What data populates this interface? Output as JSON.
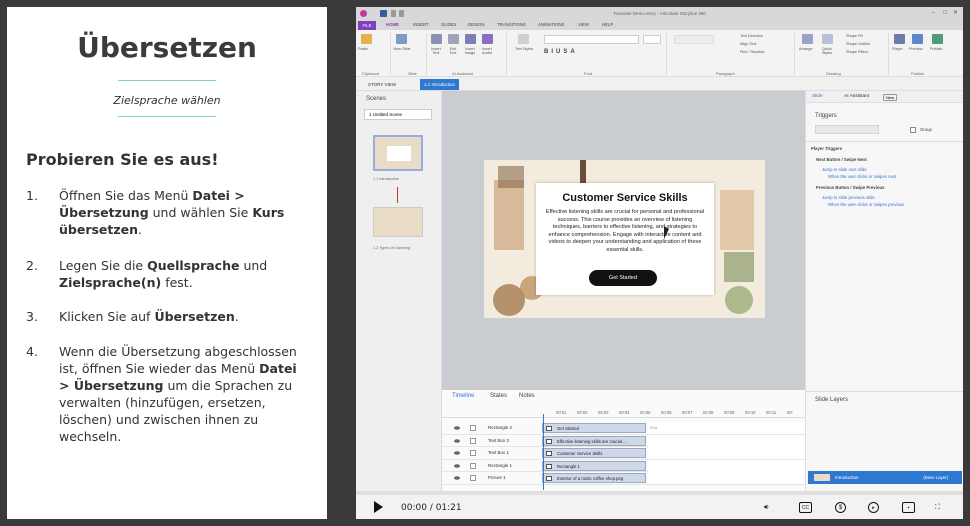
{
  "left": {
    "title": "Übersetzen",
    "subtitle": "Zielsprache wählen",
    "heading": "Probieren Sie es aus!",
    "steps": [
      {
        "num": "1.",
        "html": "Öffnen Sie das Menü <b>Datei > Übersetzung</b> und wählen Sie <b>Kurs übersetzen</b>."
      },
      {
        "num": "2.",
        "html": "Legen Sie die <b>Quellsprache</b> und <b>Zielsprache(n)</b> fest."
      },
      {
        "num": "3.",
        "html": "Klicken Sie auf <b>Übersetzen</b>."
      },
      {
        "num": "4.",
        "html": "Wenn die Übersetzung abgeschlossen ist, öffnen Sie wieder das Menü <b>Datei > Übersetzung</b> um die Sprachen zu verwalten (hinzufügen, ersetzen, löschen) und zwischen ihnen zu wechseln."
      }
    ]
  },
  "app": {
    "window_title": "Translate Demo.story - Articulate Storyline 360",
    "ribbon_tabs": [
      "FILE",
      "HOME",
      "INSERT",
      "SLIDES",
      "DESIGN",
      "TRANSITIONS",
      "ANIMATIONS",
      "VIEW",
      "HELP"
    ],
    "ribbon_groups": [
      "Clipboard",
      "Slide",
      "AI Assistant",
      "Font",
      "Paragraph",
      "Drawing",
      "Publish"
    ],
    "ribbon_buttons": [
      "Paste",
      "New Slide",
      "Insert Text",
      "Edit Text",
      "Insert Image",
      "Insert Audio",
      "Text Styles",
      "Arrange",
      "Quick Styles",
      "Player",
      "Preview",
      "Publish"
    ],
    "ribbon_small": [
      "Text Direction",
      "Align Text",
      "Find / Replace",
      "Shape Fill",
      "Shape Outline",
      "Shape Effect"
    ],
    "view_tabs": [
      "STORY VIEW",
      "1.1 Introduction"
    ],
    "scenes_header": "Scenes",
    "scene_select": "1 Untitled Scene",
    "thumbs": [
      "1.1 Introduction",
      "1.2 Types of Listening"
    ],
    "slide": {
      "title": "Customer Service Skills",
      "body": "Effective listening skills are crucial for personal and professional success. This course provides an overview of listening techniques, barriers to effective listening, and strategies to enhance comprehension. Engage with interactive content and videos to deepen your understanding and application of these essential skills.",
      "button": "Get Started"
    },
    "right_panel": {
      "tab_slide": "Slide",
      "tab_ai": "AI Assistant",
      "new_badge": "New",
      "triggers": "Triggers",
      "group": "Group",
      "player_triggers": "Player Triggers",
      "trig1_head": "Next Button / Swipe Next",
      "trig1_a": "Jump to slide next slide",
      "trig1_b": "When the user clicks or swipes next",
      "trig2_head": "Previous Button / Swipe Previous",
      "trig2_a": "Jump to slide previous slide",
      "trig2_b": "When the user clicks or swipes previous",
      "slide_layers": "Slide Layers",
      "base_layer": "Introduction",
      "base_tag": "(Base Layer)"
    },
    "timeline": {
      "tabs": [
        "Timeline",
        "States",
        "Notes"
      ],
      "ticks": [
        "00:01",
        "00:02",
        "00:03",
        "00:04",
        "00:05",
        "00:06",
        "00:07",
        "00:08",
        "00:09",
        "00:10",
        "00:11",
        "00:"
      ],
      "rows": [
        {
          "name": "Rectangle 2",
          "block": "Get Started"
        },
        {
          "name": "Text Box 2",
          "block": "Effective listening skills are crucial ..."
        },
        {
          "name": "Text Box 1",
          "block": "Customer Service Skills"
        },
        {
          "name": "Rectangle 1",
          "block": "Rectangle 1"
        },
        {
          "name": "Picture 1",
          "block": "Exterior of a rustic coffee shop.png"
        }
      ],
      "end_label": "End"
    },
    "player": {
      "time": "00:00 / 01:21"
    },
    "colors": {
      "accent_purple": "#7f3fbf",
      "accent_blue": "#2f78d1",
      "teal_rule": "#7fd3c2"
    }
  }
}
